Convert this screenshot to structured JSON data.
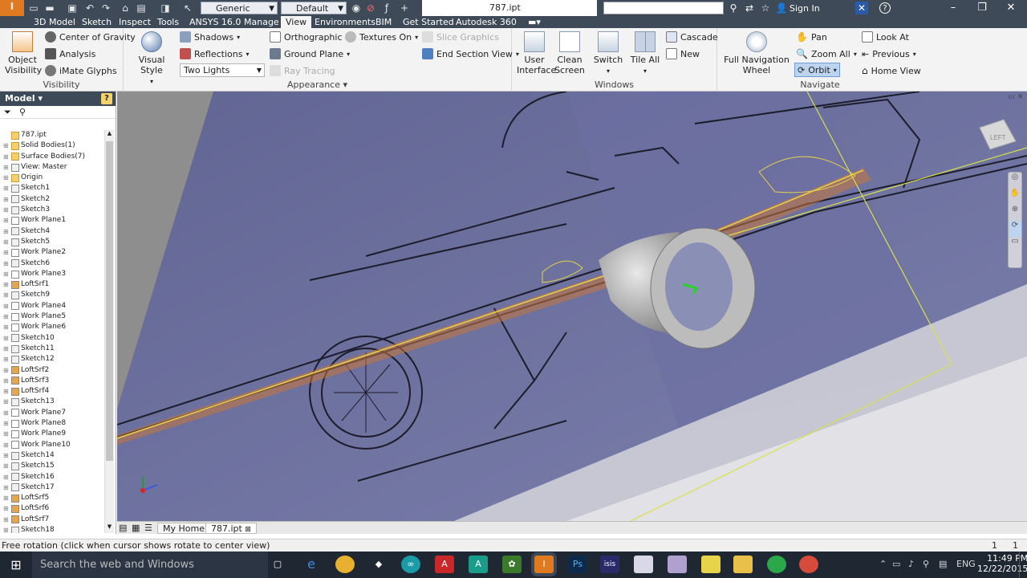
{
  "titlebar": {
    "material": "Generic",
    "appearance": "Default",
    "document_title": "787.ipt",
    "sign_in": "Sign In",
    "help": "?",
    "minimize": "–",
    "maximize": "❐",
    "close": "✕",
    "app_logo": "I"
  },
  "menu": {
    "tabs": [
      "3D Model",
      "Sketch",
      "Inspect",
      "Tools",
      "ANSYS 16.0",
      "Manage",
      "View",
      "Environments",
      "BIM",
      "Get Started",
      "Autodesk 360"
    ],
    "active": "View"
  },
  "ribbon": {
    "visibility": {
      "title": "Visibility",
      "object_visibility_1": "Object",
      "object_visibility_2": "Visibility",
      "center_of_gravity": "Center of Gravity",
      "analysis": "Analysis",
      "imate_glyphs": "iMate Glyphs"
    },
    "appearance": {
      "title": "Appearance",
      "visual_style": "Visual Style",
      "shadows": "Shadows",
      "reflections": "Reflections",
      "lighting": "Two Lights",
      "orthographic": "Orthographic",
      "ground_plane": "Ground Plane",
      "ray_tracing": "Ray Tracing",
      "textures_on": "Textures On",
      "slice_graphics": "Slice Graphics",
      "end_section_view": "End Section View"
    },
    "windows": {
      "title": "Windows",
      "user_interface_1": "User",
      "user_interface_2": "Interface",
      "clean_screen_1": "Clean",
      "clean_screen_2": "Screen",
      "switch": "Switch",
      "tile_all": "Tile All",
      "cascade": "Cascade",
      "new": "New"
    },
    "navigate": {
      "title": "Navigate",
      "full_nav_wheel_1": "Full Navigation",
      "full_nav_wheel_2": "Wheel",
      "pan": "Pan",
      "zoom_all": "Zoom All",
      "orbit": "Orbit",
      "look_at": "Look At",
      "previous": "Previous",
      "home_view": "Home View"
    }
  },
  "browser": {
    "title": "Model",
    "help": "?",
    "items": [
      {
        "label": "787.ipt",
        "icon": "fo"
      },
      {
        "label": "Solid Bodies(1)",
        "icon": "fo"
      },
      {
        "label": "Surface Bodies(7)",
        "icon": "fo"
      },
      {
        "label": "View: Master",
        "icon": "sk"
      },
      {
        "label": "Origin",
        "icon": "fo"
      },
      {
        "label": "Sketch1",
        "icon": "sk"
      },
      {
        "label": "Sketch2",
        "icon": "sk"
      },
      {
        "label": "Sketch3",
        "icon": "sk"
      },
      {
        "label": "Work Plane1",
        "icon": "wp"
      },
      {
        "label": "Sketch4",
        "icon": "sk"
      },
      {
        "label": "Sketch5",
        "icon": "sk"
      },
      {
        "label": "Work Plane2",
        "icon": "wp"
      },
      {
        "label": "Sketch6",
        "icon": "sk"
      },
      {
        "label": "Work Plane3",
        "icon": "wp"
      },
      {
        "label": "LoftSrf1",
        "icon": "lf"
      },
      {
        "label": "Sketch9",
        "icon": "sk"
      },
      {
        "label": "Work Plane4",
        "icon": "wp"
      },
      {
        "label": "Work Plane5",
        "icon": "wp"
      },
      {
        "label": "Work Plane6",
        "icon": "wp"
      },
      {
        "label": "Sketch10",
        "icon": "sk"
      },
      {
        "label": "Sketch11",
        "icon": "sk"
      },
      {
        "label": "Sketch12",
        "icon": "sk"
      },
      {
        "label": "LoftSrf2",
        "icon": "lf"
      },
      {
        "label": "LoftSrf3",
        "icon": "lf"
      },
      {
        "label": "LoftSrf4",
        "icon": "lf"
      },
      {
        "label": "Sketch13",
        "icon": "sk"
      },
      {
        "label": "Work Plane7",
        "icon": "wp"
      },
      {
        "label": "Work Plane8",
        "icon": "wp"
      },
      {
        "label": "Work Plane9",
        "icon": "wp"
      },
      {
        "label": "Work Plane10",
        "icon": "wp"
      },
      {
        "label": "Sketch14",
        "icon": "sk"
      },
      {
        "label": "Sketch15",
        "icon": "sk"
      },
      {
        "label": "Sketch16",
        "icon": "sk"
      },
      {
        "label": "Sketch17",
        "icon": "sk"
      },
      {
        "label": "LoftSrf5",
        "icon": "lf"
      },
      {
        "label": "LoftSrf6",
        "icon": "lf"
      },
      {
        "label": "LoftSrf7",
        "icon": "lf"
      },
      {
        "label": "Sketch18",
        "icon": "sk"
      }
    ]
  },
  "viewport": {
    "viewcube_label": "LEFT"
  },
  "doctabs": {
    "home": "My Home",
    "file": "787.ipt"
  },
  "status": {
    "text": "Free rotation (click when cursor shows rotate to center view)",
    "count1": "1",
    "count2": "1"
  },
  "taskbar": {
    "search_placeholder": "Search the web and Windows",
    "language": "ENG",
    "time": "11:49 PM",
    "date": "12/22/2015",
    "apps": [
      "Ps",
      "isis"
    ]
  }
}
